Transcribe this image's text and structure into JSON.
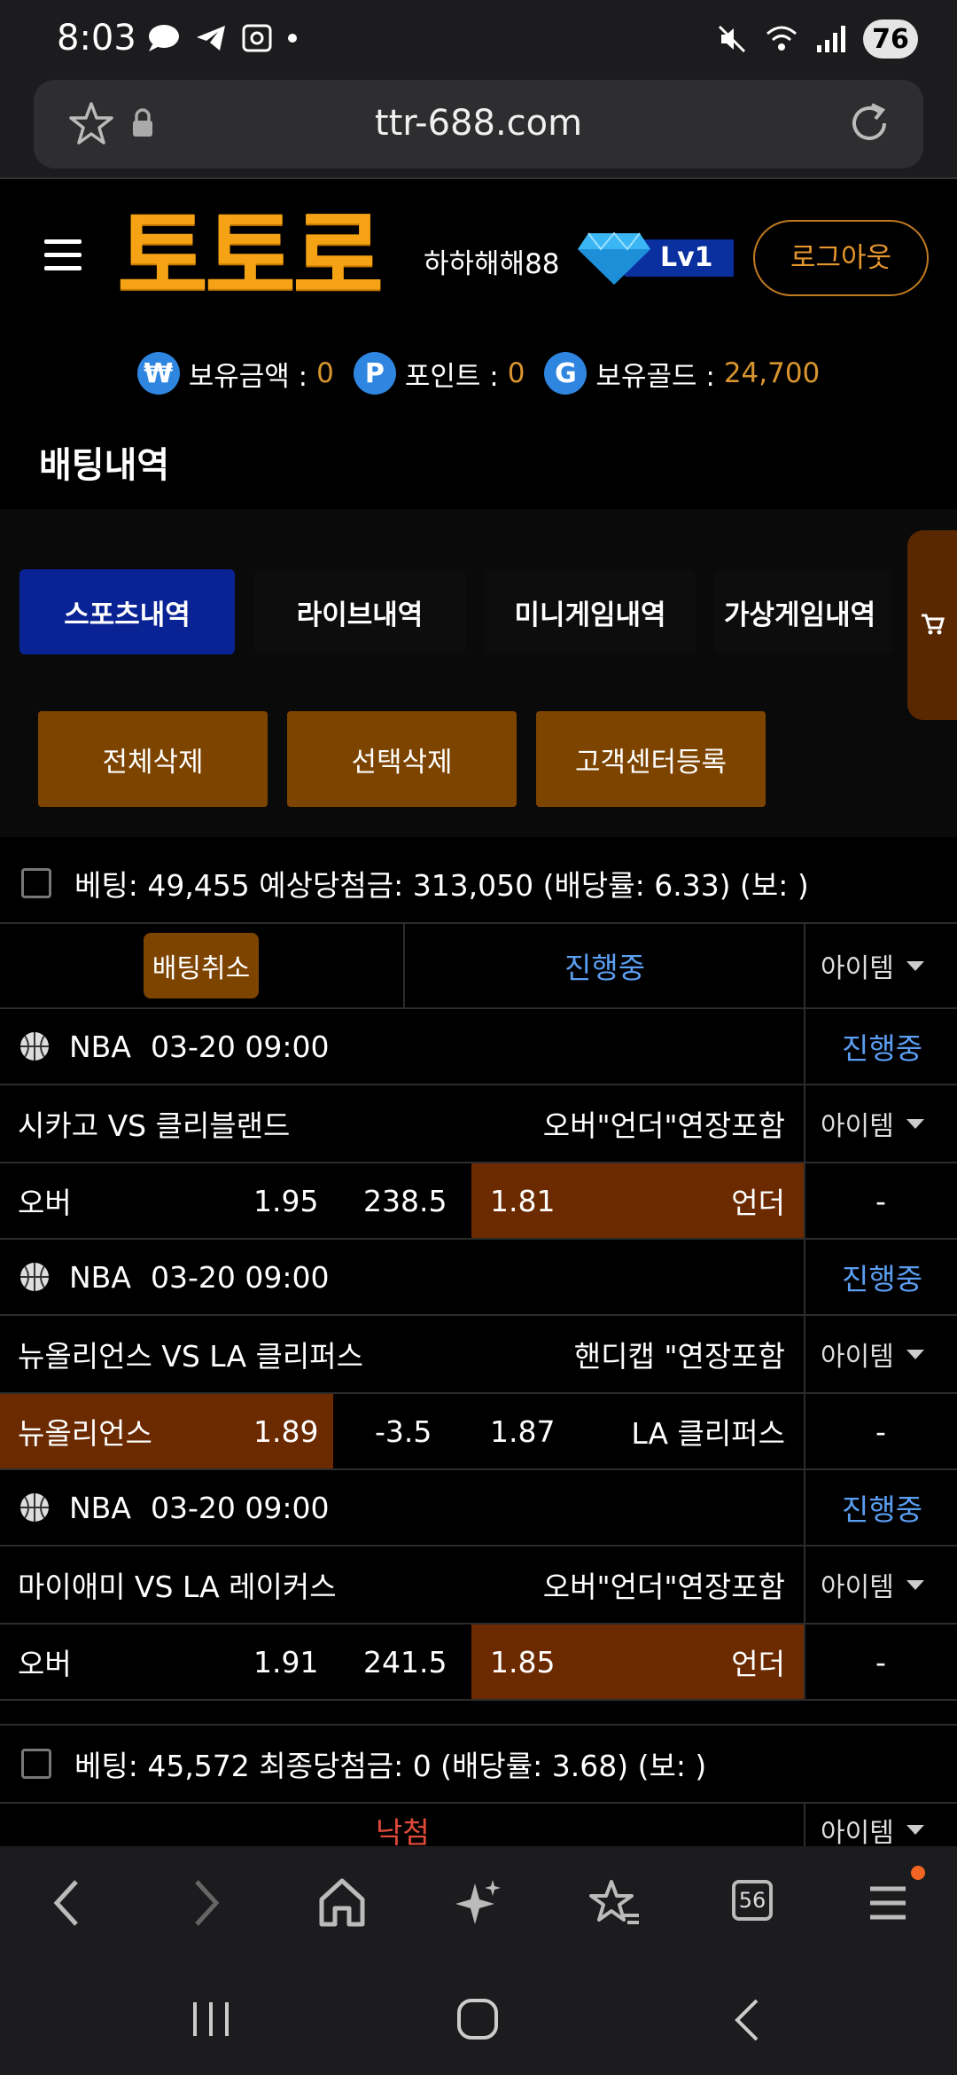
{
  "status": {
    "time": "8:03",
    "battery": "76"
  },
  "browser": {
    "url": "ttr-688.com",
    "tab_count": "56"
  },
  "header": {
    "logo": "토토로",
    "username": "하하해해88",
    "level": "Lv1",
    "logout_label": "로그아웃"
  },
  "balances": [
    {
      "icon": "₩",
      "label": "보유금액 :",
      "value": "0"
    },
    {
      "icon": "P",
      "label": "포인트 :",
      "value": "0"
    },
    {
      "icon": "G",
      "label": "보유골드 :",
      "value": "24,700"
    }
  ],
  "section_title": "배팅내역",
  "tabs": [
    "스포츠내역",
    "라이브내역",
    "미니게임내역",
    "가상게임내역"
  ],
  "actions": [
    "전체삭제",
    "선택삭제",
    "고객센터등록"
  ],
  "bet1": {
    "summary": "베팅: 49,455 예상당첨금: 313,050 (배당률: 6.33) (보: )",
    "cancel_label": "배팅취소",
    "status": "진행중",
    "item_label": "아이템",
    "games": [
      {
        "league": "NBA",
        "datetime": "03-20 09:00",
        "status": "진행중",
        "matchup": "시카고 VS 클리블랜드",
        "market": "오버\"언더\"연장포함",
        "item_label": "아이템",
        "left": "오버",
        "left_odds": "1.95",
        "line": "238.5",
        "right_odds": "1.81",
        "right": "언더",
        "extra": "-"
      },
      {
        "league": "NBA",
        "datetime": "03-20 09:00",
        "status": "진행중",
        "matchup": "뉴올리언스 VS LA 클리퍼스",
        "market": "핸디캡 \"연장포함",
        "item_label": "아이템",
        "left": "뉴올리언스",
        "left_odds": "1.89",
        "line": "-3.5",
        "right_odds": "1.87",
        "right": "LA 클리퍼스",
        "extra": "-"
      },
      {
        "league": "NBA",
        "datetime": "03-20 09:00",
        "status": "진행중",
        "matchup": "마이애미 VS LA 레이커스",
        "market": "오버\"언더\"연장포함",
        "item_label": "아이템",
        "left": "오버",
        "left_odds": "1.91",
        "line": "241.5",
        "right_odds": "1.85",
        "right": "언더",
        "extra": "-"
      }
    ]
  },
  "bet2": {
    "summary": "베팅: 45,572 최종당첨금: 0 (배당률: 3.68) (보: )",
    "result": "낙첨",
    "item_label": "아이템"
  }
}
